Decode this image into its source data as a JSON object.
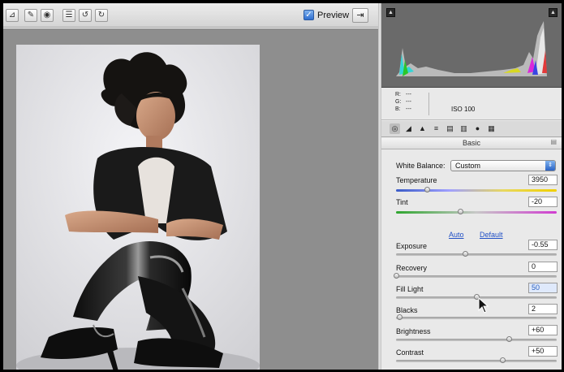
{
  "toolbar": {
    "tools": [
      {
        "name": "straighten-tool-icon",
        "glyph": "⊿"
      },
      {
        "name": "retouch-tool-icon",
        "glyph": "✎"
      },
      {
        "name": "red-eye-tool-icon",
        "glyph": "◉"
      },
      {
        "name": "preferences-icon",
        "glyph": "☰"
      },
      {
        "name": "rotate-left-icon",
        "glyph": "↺"
      },
      {
        "name": "rotate-right-icon",
        "glyph": "↻"
      }
    ],
    "preview_checked": true,
    "preview_check_glyph": "✓",
    "preview_label": "Preview",
    "fullscreen_glyph": "⇥"
  },
  "histogram": {
    "clip_shadow_glyph": "▲",
    "clip_highlight_glyph": "▲"
  },
  "readout": {
    "r_label": "R:",
    "r_value": "---",
    "g_label": "G:",
    "g_value": "---",
    "b_label": "B:",
    "b_value": "---",
    "iso": "ISO 100"
  },
  "tabs": [
    {
      "name": "tab-basic-icon",
      "glyph": "◎"
    },
    {
      "name": "tab-tone-curve-icon",
      "glyph": "◢"
    },
    {
      "name": "tab-detail-icon",
      "glyph": "▲"
    },
    {
      "name": "tab-hsl-icon",
      "glyph": "≡"
    },
    {
      "name": "tab-split-toning-icon",
      "glyph": "▤"
    },
    {
      "name": "tab-lens-icon",
      "glyph": "▥"
    },
    {
      "name": "tab-camera-calibration-icon",
      "glyph": "●"
    },
    {
      "name": "tab-presets-icon",
      "glyph": "▦"
    }
  ],
  "panel": {
    "title": "Basic",
    "menu_glyph": "▤"
  },
  "white_balance": {
    "label": "White Balance:",
    "value": "Custom",
    "arrow_glyph": "⇕"
  },
  "links": {
    "auto": "Auto",
    "default": "Default"
  },
  "sliders": [
    {
      "key": "temperature",
      "label": "Temperature",
      "value": "3950",
      "position": 0.19
    },
    {
      "key": "tint",
      "label": "Tint",
      "value": "-20",
      "position": 0.4
    },
    {
      "key": "exposure",
      "label": "Exposure",
      "value": "-0.55",
      "position": 0.43
    },
    {
      "key": "recovery",
      "label": "Recovery",
      "value": "0",
      "position": 0.0
    },
    {
      "key": "fill_light",
      "label": "Fill Light",
      "value": "50",
      "position": 0.5
    },
    {
      "key": "blacks",
      "label": "Blacks",
      "value": "2",
      "position": 0.02
    },
    {
      "key": "brightness",
      "label": "Brightness",
      "value": "+60",
      "position": 0.7
    },
    {
      "key": "contrast",
      "label": "Contrast",
      "value": "+50",
      "position": 0.66
    }
  ]
}
